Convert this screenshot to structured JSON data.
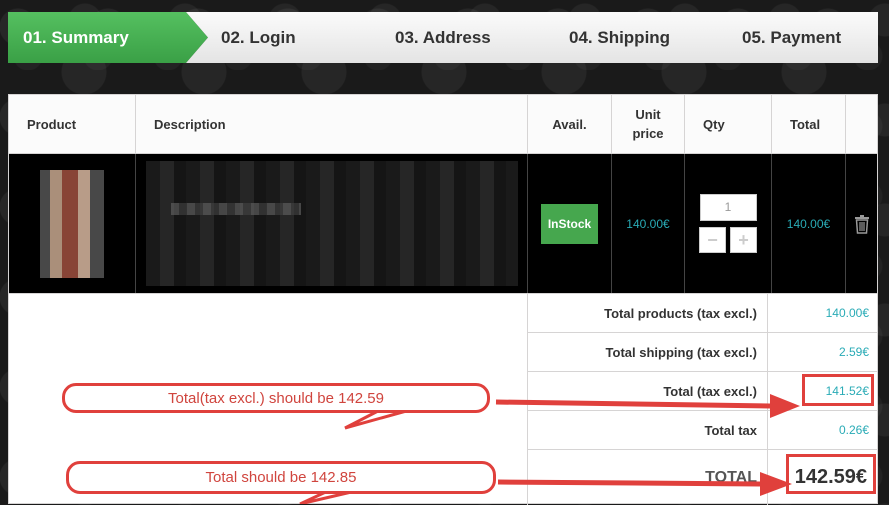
{
  "steps": [
    {
      "label": "01. Summary",
      "active": true
    },
    {
      "label": "02. Login",
      "active": false
    },
    {
      "label": "03. Address",
      "active": false
    },
    {
      "label": "04. Shipping",
      "active": false
    },
    {
      "label": "05. Payment",
      "active": false
    }
  ],
  "table": {
    "headers": {
      "product": "Product",
      "description": "Description",
      "avail": "Avail.",
      "unit_price_line1": "Unit",
      "unit_price_line2": "price",
      "qty": "Qty",
      "total": "Total"
    },
    "item": {
      "availability_line1": "In",
      "availability_line2": "Stock",
      "unit_price": "140.00€",
      "quantity": "1",
      "total": "140.00€"
    }
  },
  "summary": [
    {
      "label": "Total products (tax excl.)",
      "value": "140.00€"
    },
    {
      "label": "Total shipping (tax excl.)",
      "value": "2.59€"
    },
    {
      "label": "Total (tax excl.)",
      "value": "141.52€"
    },
    {
      "label": "Total tax",
      "value": "0.26€"
    },
    {
      "label": "TOTAL",
      "value": "142.59€"
    }
  ],
  "annotations": {
    "note1": "Total(tax excl.) should be 142.59",
    "note2": "Total should be 142.85"
  },
  "colors": {
    "active_step": "#46a74e",
    "price": "#29abb6",
    "annotation": "#e0403c"
  }
}
